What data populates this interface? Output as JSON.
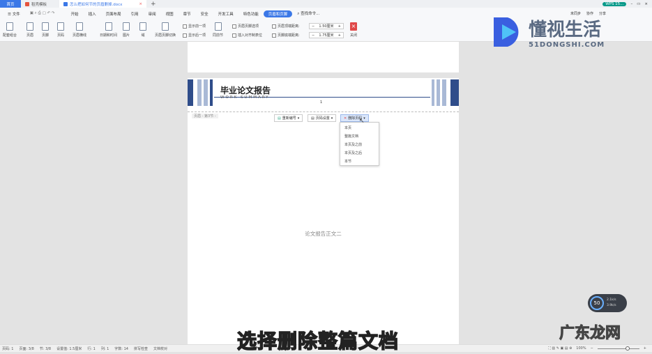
{
  "tabs": [
    {
      "label": "首页"
    },
    {
      "label": "稻壳模板"
    },
    {
      "label": "怎么把如何节的页眉删掉.docx"
    }
  ],
  "window": {
    "account": "WPS 15..."
  },
  "menu": {
    "file": "文件",
    "items": [
      "开始",
      "插入",
      "页面布局",
      "引用",
      "审阅",
      "视图",
      "章节",
      "安全",
      "开发工具",
      "特色功能",
      "页眉和页脚"
    ],
    "search": "查找命令..."
  },
  "right_actions": {
    "sync": "未同步",
    "collab": "协作",
    "share": "分享"
  },
  "toolbar": {
    "items": [
      "配套组合",
      "页眉",
      "页脚",
      "页码",
      "页眉横线",
      "日期和时间",
      "图片",
      "域",
      "页眉页脚切换"
    ],
    "show_prev": "显示前一项",
    "show_next": "显示后一项",
    "same_as_prev": "同前节",
    "page_diff": "页眉页脚选项",
    "insert_align": "插入对齐制表位",
    "header_top_label": "页眉顶端距离:",
    "header_top": "1.50厘米",
    "footer_bottom_label": "页脚底端距离:",
    "footer_bottom": "1.75厘米",
    "close": "关闭"
  },
  "document": {
    "header_title": "毕业论文报告",
    "header_subtitle": "WORK SUMMARY",
    "page_number": "1",
    "header_tag": "页眉 - 第3节 -",
    "renumber": "重新编号",
    "page_settings": "页码设置",
    "delete_page_num": "删除页码",
    "dropdown": [
      "本页",
      "整篇文档",
      "本页及之前",
      "本页及之后",
      "本节"
    ],
    "body_text": "论文报告正文二"
  },
  "subtitle": "选择删除整篇文档",
  "status": {
    "items": [
      "页码: 1",
      "页面: 3/8",
      "节: 3/8",
      "设置值: 1.5厘米",
      "行: 1",
      "列: 1",
      "字数: 14",
      "拼写检查",
      "文档校对"
    ],
    "zoom": "100%"
  },
  "speed": {
    "percent": "50",
    "up": "2.1k/s",
    "down": "3.9k/s"
  },
  "watermark": {
    "brand": "懂视生活",
    "url": "51DONGSHI.COM",
    "brand2": "广东龙网"
  },
  "colors": {
    "accent": "#3b78e7",
    "header_blue": "#2f4d8a",
    "close_red": "#e04848"
  }
}
